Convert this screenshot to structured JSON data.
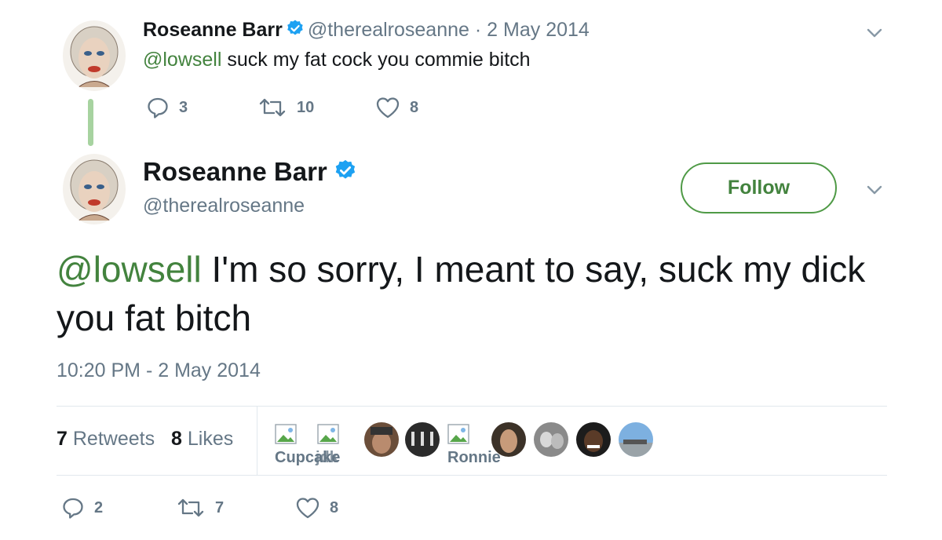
{
  "reply_tweet": {
    "author_name": "Roseanne Barr",
    "handle": "@therealroseanne",
    "separator": "·",
    "date": "2 May 2014",
    "mention": "@lowsell",
    "text": " suck my fat cock you commie bitch",
    "actions": {
      "replies": "3",
      "retweets": "10",
      "likes": "8"
    }
  },
  "main_tweet": {
    "author_name": "Roseanne Barr",
    "handle": "@therealroseanne",
    "follow_label": "Follow",
    "mention": "@lowsell",
    "text": " I'm so sorry, I meant to say, suck my dick you fat bitch",
    "timestamp": "10:20 PM - 2 May 2014",
    "retweet_count": "7",
    "retweet_label": "Retweets",
    "like_count": "8",
    "like_label": "Likes",
    "liker_names": [
      "Cupcake",
      "jdk",
      "Ronnie"
    ],
    "actions": {
      "replies": "2",
      "retweets": "7",
      "likes": "8"
    }
  },
  "colors": {
    "accent_green": "#43833e",
    "muted": "#657786",
    "verified_blue": "#1da1f2"
  },
  "icons": [
    "avatar-portrait",
    "verified-badge-icon",
    "chevron-down-icon",
    "reply-icon",
    "retweet-icon",
    "like-icon",
    "broken-image-icon"
  ]
}
